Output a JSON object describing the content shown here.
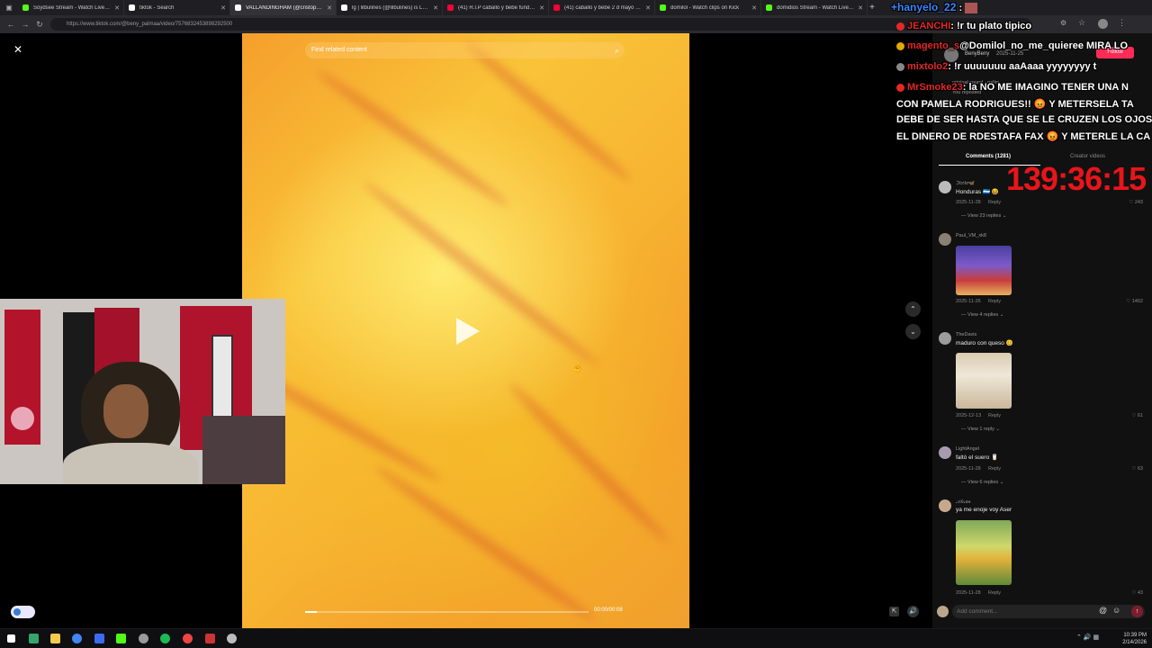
{
  "browser": {
    "tabs": [
      {
        "title": "Soydsee Stream - Watch Live on Kick",
        "color": "#53fc18"
      },
      {
        "title": "tiktok - Search",
        "color": "#ffffff"
      },
      {
        "title": "VALLANDINGHAM (@cristopher...)",
        "color": "#ffffff"
      },
      {
        "title": "lg | lilbulines (@lilbulines) is LIVE",
        "color": "#ffffff"
      },
      {
        "title": "(41) R.I.P caballo y bebe fundando",
        "color": "#ff0033"
      },
      {
        "title": "(41) caballo y bebe 2 d mayo - Yo",
        "color": "#ff0033"
      },
      {
        "title": "domilol - Watch clips on Kick",
        "color": "#53fc18"
      },
      {
        "title": "domidios Stream - Watch Live on",
        "color": "#53fc18"
      }
    ],
    "url": "https://www.tiktok.com/@beny_palmaa/video/7576832453898292500"
  },
  "video": {
    "search_placeholder": "Find related content",
    "timecode": "00:00/00:08",
    "progress": 0.04
  },
  "comments_panel": {
    "author": "BenyBeny",
    "post_date": "2025-11-25",
    "follow_label": "Follow",
    "reposted": "You reposted",
    "sound": "original sound - pallm",
    "tab_comments": "Comments (1281)",
    "tab_creator": "Creator videos",
    "add_comment_placeholder": "Add comment...",
    "comments": [
      {
        "user": "ℑ𝔦𝔯𝔬𝔨𝔬🦋",
        "text": "Honduras 🇭🇳 😆",
        "date": "2025-11-28",
        "reply": "Reply",
        "likes": "243",
        "view_replies": "View 23 replies"
      },
      {
        "user": "Paul_VM_xk8",
        "text": "",
        "date": "2025-11-26",
        "reply": "Reply",
        "likes": "1462",
        "view_replies": "View 4 replies"
      },
      {
        "user": "TheDavis",
        "text": "maduro con queso 😊",
        "date": "2025-12-13",
        "reply": "Reply",
        "likes": "61",
        "view_replies": "View 1 reply"
      },
      {
        "user": "LightAngel",
        "text": "faltó el suero 🥛",
        "date": "2025-11-28",
        "reply": "Reply",
        "likes": "63",
        "view_replies": "View 6 replies"
      },
      {
        "user": "𝒜𝓁𝒾𝓈𝑜𝓃",
        "text": "ya me enoje voy Aser",
        "date": "2025-11-28",
        "reply": "Reply",
        "likes": "43",
        "view_replies": ""
      }
    ]
  },
  "stream_overlay": {
    "top_user": "hanyelo_22",
    "chat": [
      {
        "user": "JEANCHI",
        "msg": ": !r tu plato tipico"
      },
      {
        "user": "magento_s",
        "msg": "@Domilol_no_me_quieree MIRA LO"
      },
      {
        "user": "mixtolo2",
        "msg": ": !r uuuuuuu aaAaaa yyyyyyyy t"
      },
      {
        "user": "MrSmoke23",
        "msg": ": la NO ME IMAGINO TENER UNA N"
      },
      {
        "user": "",
        "msg": "CON PAMELA RODRIGUES!! 😡 Y METERSELA TA"
      },
      {
        "user": "",
        "msg": "DEBE DE SER HASTA QUE SE LE CRUZEN LOS OJOS"
      },
      {
        "user": "",
        "msg": "EL DINERO DE RDESTAFA FAX 😡 Y METERLE LA CA"
      }
    ],
    "timer": "139:36:15"
  },
  "taskbar": {
    "time": "10:39 PM",
    "date": "2/14/2026"
  },
  "icons": {
    "close": "close-icon",
    "search": "search-icon",
    "play": "play-icon",
    "up": "chevron-up-icon",
    "down": "chevron-down-icon",
    "at": "at-icon",
    "emoji": "emoji-icon",
    "send": "send-icon"
  },
  "colors": {
    "timer": "#e8151a",
    "chat_user": "#e52727",
    "kick_green": "#53fc18",
    "tiktok_pink": "#fe2c55"
  }
}
